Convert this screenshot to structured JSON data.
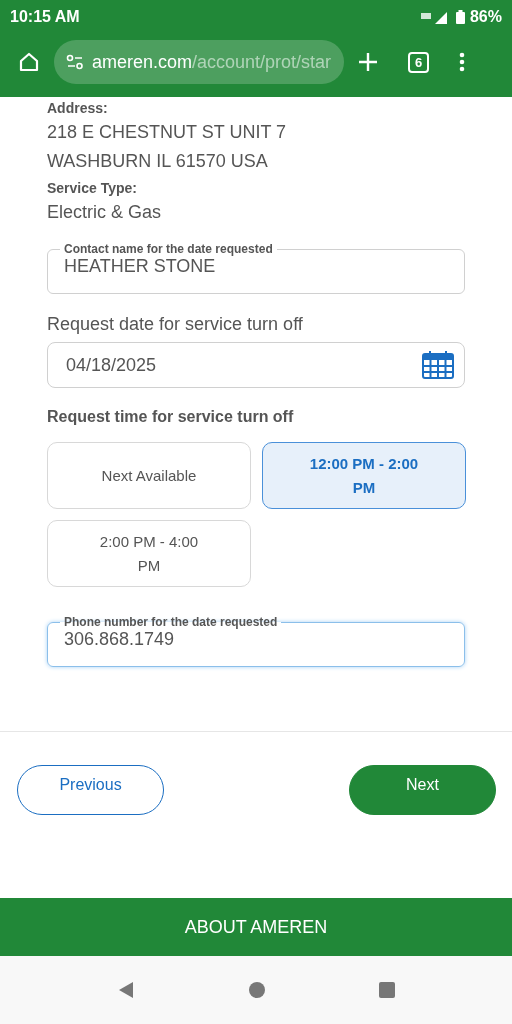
{
  "status_bar": {
    "time": "10:15 AM",
    "battery": "86%"
  },
  "browser": {
    "url_host": "ameren.com",
    "url_path": "/account/prot/star",
    "tab_count": "6"
  },
  "details": [
    {
      "kind": "label",
      "text": "Address:"
    },
    {
      "kind": "value",
      "text": "218 E CHESTNUT ST UNIT 7"
    },
    {
      "kind": "value",
      "text": "WASHBURN IL 61570 USA"
    },
    {
      "kind": "label",
      "text": "Service Type:"
    },
    {
      "kind": "value",
      "text": "Electric & Gas"
    }
  ],
  "contact_field": {
    "label": "Contact name for the date requested",
    "value": "HEATHER STONE",
    "focused": false
  },
  "date_field": {
    "label": "Request date for service turn off",
    "value": "04/18/2025"
  },
  "time_section": {
    "title": "Request time for service turn off",
    "options": [
      {
        "label": "Next Available",
        "selected": false
      },
      {
        "label": "12:00 PM - 2:00 PM",
        "selected": true
      },
      {
        "label": "2:00 PM - 4:00 PM",
        "selected": false
      }
    ]
  },
  "phone_field": {
    "label": "Phone number for the date requested",
    "value": "306.868.1749",
    "focused": true
  },
  "buttons": [
    {
      "kind": "secondary",
      "label": "Previous"
    },
    {
      "kind": "primary",
      "label": "Next"
    }
  ],
  "footer": {
    "link": "ABOUT AMEREN"
  }
}
